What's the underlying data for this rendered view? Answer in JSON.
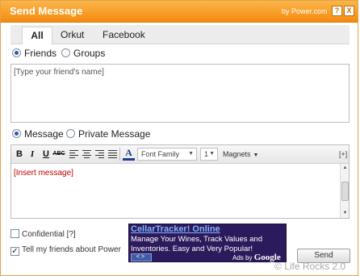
{
  "window": {
    "title": "Send Message",
    "byline": "by Power.com",
    "help_label": "?",
    "close_label": "X"
  },
  "tabs": [
    {
      "label": "All",
      "active": true
    },
    {
      "label": "Orkut",
      "active": false
    },
    {
      "label": "Facebook",
      "active": false
    }
  ],
  "recipients": {
    "options": [
      {
        "label": "Friends",
        "selected": true
      },
      {
        "label": "Groups",
        "selected": false
      }
    ],
    "friends_placeholder": "[Type your friend's name]"
  },
  "message_type": {
    "options": [
      {
        "label": "Message",
        "selected": true
      },
      {
        "label": "Private Message",
        "selected": false
      }
    ]
  },
  "editor": {
    "toolbar": {
      "bold": "B",
      "italic": "I",
      "underline": "U",
      "strike": "ABC",
      "font_color": "A",
      "font_family": "Font Family",
      "font_size": "1",
      "magnets": "Magnets",
      "expand": "[+]"
    },
    "message_placeholder": "[Insert message]",
    "message_color": "#c00000"
  },
  "options": {
    "confidential": {
      "label": "Confidential [?]",
      "checked": false
    },
    "tell_friends": {
      "label": "Tell my friends about Power",
      "checked": true
    }
  },
  "ad": {
    "title": "CellarTracker! Online",
    "body": "Manage Your Wines, Track Values and Inventories. Easy and Very Popular!",
    "nav": "<>",
    "by_prefix": "Ads by",
    "by_brand": "Google"
  },
  "send_label": "Send",
  "watermark": "© Life Rocks 2.0",
  "colors": {
    "accent": "#f48b0f",
    "radio_dot": "#2b57a8",
    "ad_bg": "#2d1a5c"
  }
}
